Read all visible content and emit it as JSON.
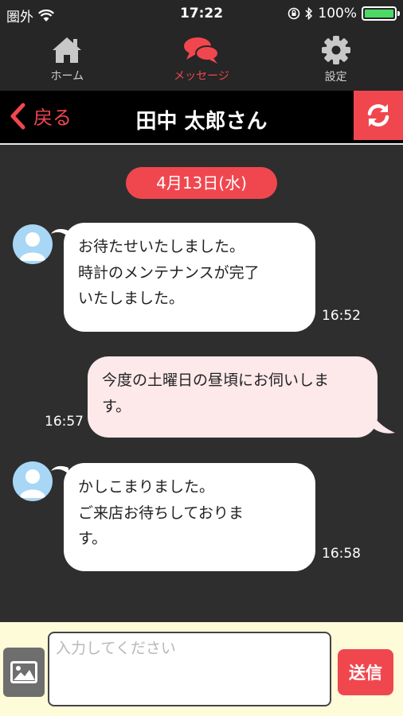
{
  "status_bar": {
    "carrier": "圏外",
    "time": "17:22",
    "battery": "100%"
  },
  "tabs": [
    {
      "label": "ホーム",
      "icon": "home-icon"
    },
    {
      "label": "メッセージ",
      "icon": "chat-bubbles-icon",
      "active": true
    },
    {
      "label": "設定",
      "icon": "gear-icon"
    }
  ],
  "header": {
    "back_label": "戻る",
    "title": "田中 太郎さん"
  },
  "chat": {
    "date": "4月13日(水)",
    "messages": [
      {
        "direction": "in",
        "lines": [
          "お待たせいたしました。",
          "時計のメンテナンスが完了",
          "いたしました。"
        ],
        "time": "16:52"
      },
      {
        "direction": "out",
        "lines": [
          "今度の土曜日の昼頃にお伺いしま",
          "す。"
        ],
        "time": "16:57"
      },
      {
        "direction": "in",
        "lines": [
          "かしこまりました。",
          "ご来店お待ちしておりま",
          "す。"
        ],
        "time": "16:58"
      }
    ]
  },
  "input_bar": {
    "placeholder": "入力してください",
    "value": "",
    "send_label": "送信"
  },
  "colors": {
    "accent": "#f0474f",
    "background": "#2e2e2e",
    "incoming_bubble": "#ffffff",
    "outgoing_bubble": "#fde8ea",
    "input_bar": "#fdfbd8",
    "battery": "#4cd964"
  }
}
